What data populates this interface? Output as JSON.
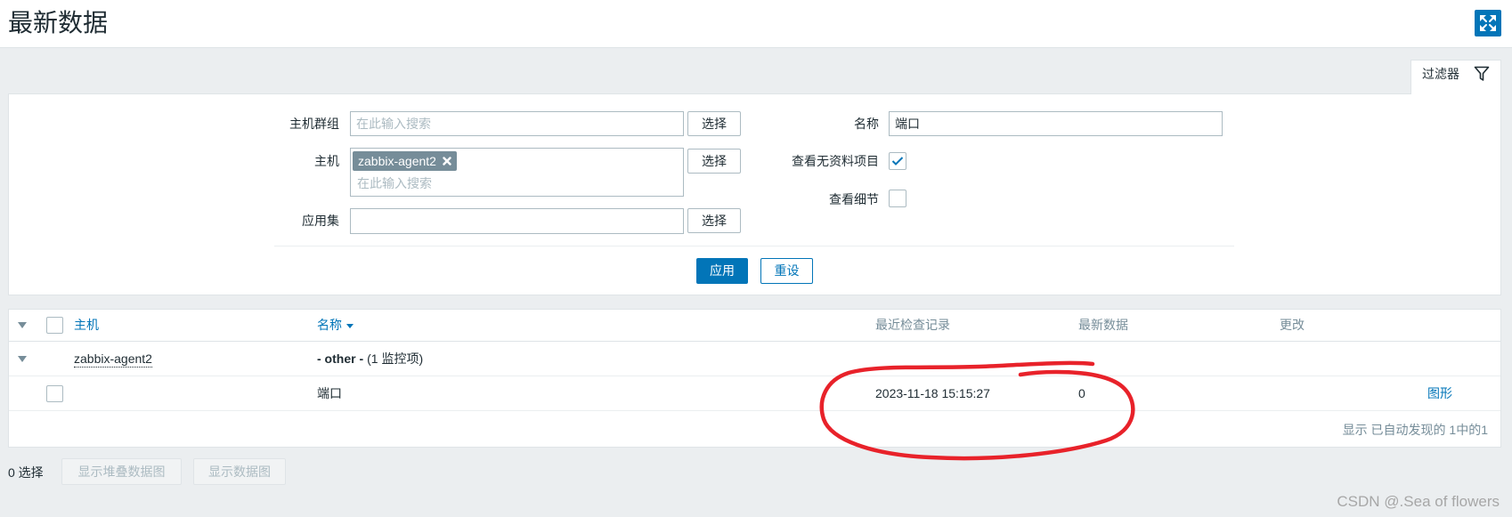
{
  "header": {
    "title": "最新数据"
  },
  "filter": {
    "tab_label": "过滤器",
    "host_groups": {
      "label": "主机群组",
      "placeholder": "在此输入搜索",
      "value": "",
      "select_label": "选择"
    },
    "hosts": {
      "label": "主机",
      "tags": [
        "zabbix-agent2"
      ],
      "placeholder": "在此输入搜索",
      "select_label": "选择"
    },
    "application": {
      "label": "应用集",
      "value": "",
      "select_label": "选择"
    },
    "name": {
      "label": "名称",
      "value": "端口"
    },
    "show_without_data": {
      "label": "查看无资料项目",
      "checked": true
    },
    "show_details": {
      "label": "查看细节",
      "checked": false
    },
    "apply_label": "应用",
    "reset_label": "重设"
  },
  "table": {
    "select_all_checked": false,
    "columns": {
      "host": "主机",
      "name": "名称",
      "last_check": "最近检查记录",
      "last_value": "最新数据",
      "change": "更改"
    },
    "groups": [
      {
        "host": "zabbix-agent2",
        "application": "- other -",
        "item_count": "(1 监控项)",
        "items": [
          {
            "checked": false,
            "name": "端口",
            "last_check": "2023-11-18 15:15:27",
            "last_value": "0",
            "change": "",
            "action": "图形"
          }
        ]
      }
    ],
    "footer": "显示 已自动发现的 1中的1"
  },
  "actions": {
    "selected_count": "0 选择",
    "stacked_graph_label": "显示堆叠数据图",
    "graph_label": "显示数据图"
  },
  "watermark": "CSDN @.Sea of flowers",
  "icons": {
    "fullscreen": "fullscreen-icon",
    "filter": "funnel-icon",
    "tag_remove": "remove-icon",
    "collapse": "collapse-triangle-icon",
    "sort": "sort-desc-icon",
    "check": "checkmark-icon"
  },
  "colors": {
    "accent": "#0275b8",
    "background": "#ebeef0",
    "text": "#1f2c33",
    "muted": "#768d99",
    "tag": "#768d99",
    "annotation": "#e8222a"
  }
}
